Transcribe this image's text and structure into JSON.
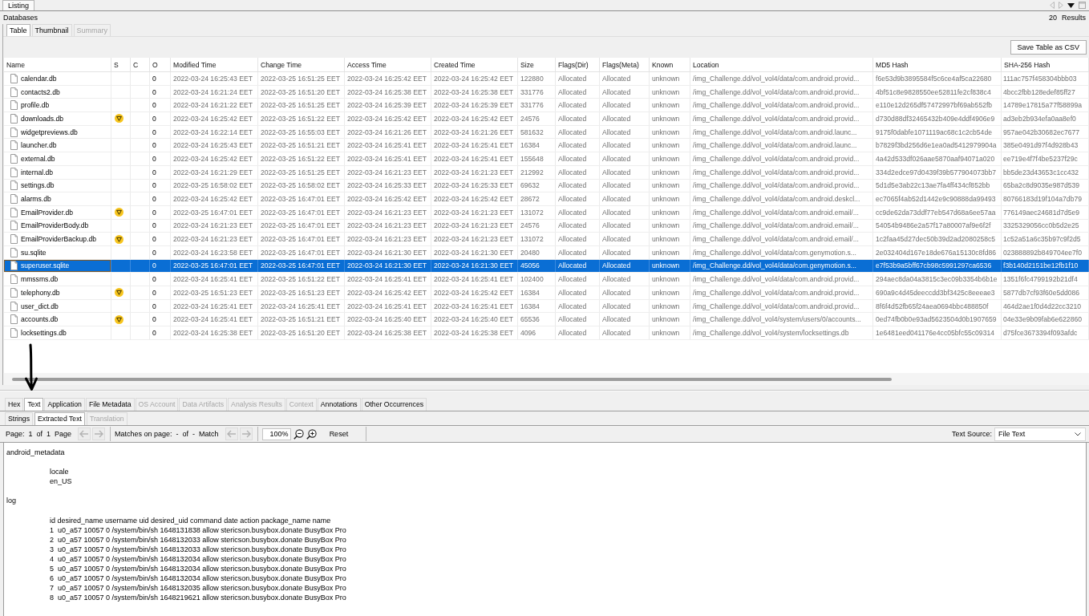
{
  "view_tabs": [
    {
      "label": "Listing",
      "selected": true
    }
  ],
  "breadcrumb": "Databases",
  "results": {
    "count": "20",
    "label": "Results"
  },
  "listing_tabs": [
    {
      "label": "Table",
      "selected": true,
      "disabled": false
    },
    {
      "label": "Thumbnail",
      "selected": false,
      "disabled": false
    },
    {
      "label": "Summary",
      "selected": false,
      "disabled": true
    }
  ],
  "save_button": "Save Table as CSV",
  "table": {
    "columns": [
      "Name",
      "S",
      "C",
      "O",
      "Modified Time",
      "Change Time",
      "Access Time",
      "Created Time",
      "Size",
      "Flags(Dir)",
      "Flags(Meta)",
      "Known",
      "Location",
      "MD5 Hash",
      "SHA-256 Hash"
    ],
    "rows": [
      {
        "name": "calendar.db",
        "score_marked": false,
        "o": "0",
        "modified": "2022-03-24 16:25:43 EET",
        "changed": "2022-03-25 16:51:25 EET",
        "accessed": "2022-03-24 16:25:42 EET",
        "created": "2022-03-24 16:25:42 EET",
        "size": "122880",
        "flags_dir": "Allocated",
        "flags_meta": "Allocated",
        "known": "unknown",
        "location": "/img_Challenge.dd/vol_vol4/data/com.android.provid...",
        "md5": "f6e53d9b3895584f5c6ce4af5ca22680",
        "sha256": "111ac757f458304bbb03",
        "selected": false
      },
      {
        "name": "contacts2.db",
        "score_marked": false,
        "o": "0",
        "modified": "2022-03-24 16:21:24 EET",
        "changed": "2022-03-25 16:51:20 EET",
        "accessed": "2022-03-24 16:25:38 EET",
        "created": "2022-03-24 16:25:38 EET",
        "size": "331776",
        "flags_dir": "Allocated",
        "flags_meta": "Allocated",
        "known": "unknown",
        "location": "/img_Challenge.dd/vol_vol4/data/com.android.provid...",
        "md5": "4bf51c8e9828550ee52811fe2cf838c4",
        "sha256": "4bcc2fbb128edef85ff27",
        "selected": false
      },
      {
        "name": "profile.db",
        "score_marked": false,
        "o": "0",
        "modified": "2022-03-24 16:21:22 EET",
        "changed": "2022-03-25 16:51:25 EET",
        "accessed": "2022-03-24 16:25:39 EET",
        "created": "2022-03-24 16:25:39 EET",
        "size": "331776",
        "flags_dir": "Allocated",
        "flags_meta": "Allocated",
        "known": "unknown",
        "location": "/img_Challenge.dd/vol_vol4/data/com.android.provid...",
        "md5": "e110e12d265df57472997bf69ab552fb",
        "sha256": "14789e17815a77f58899a",
        "selected": false
      },
      {
        "name": "downloads.db",
        "score_marked": true,
        "o": "0",
        "modified": "2022-03-24 16:25:42 EET",
        "changed": "2022-03-25 16:51:22 EET",
        "accessed": "2022-03-24 16:25:42 EET",
        "created": "2022-03-24 16:25:42 EET",
        "size": "24576",
        "flags_dir": "Allocated",
        "flags_meta": "Allocated",
        "known": "unknown",
        "location": "/img_Challenge.dd/vol_vol4/data/com.android.provid...",
        "md5": "d730d88df32465432b409e4ddf4906e9",
        "sha256": "ad3eb2b934efa0aa8ef0",
        "selected": false
      },
      {
        "name": "widgetpreviews.db",
        "score_marked": false,
        "o": "0",
        "modified": "2022-03-24 16:22:14 EET",
        "changed": "2022-03-25 16:55:03 EET",
        "accessed": "2022-03-24 16:21:26 EET",
        "created": "2022-03-24 16:21:26 EET",
        "size": "581632",
        "flags_dir": "Allocated",
        "flags_meta": "Allocated",
        "known": "unknown",
        "location": "/img_Challenge.dd/vol_vol4/data/com.android.launc...",
        "md5": "9175f0dabfe1071119ac68c1c2cb54de",
        "sha256": "957ae042b30682ec7677",
        "selected": false
      },
      {
        "name": "launcher.db",
        "score_marked": false,
        "o": "0",
        "modified": "2022-03-24 16:25:43 EET",
        "changed": "2022-03-25 16:51:21 EET",
        "accessed": "2022-03-24 16:25:41 EET",
        "created": "2022-03-24 16:25:41 EET",
        "size": "16384",
        "flags_dir": "Allocated",
        "flags_meta": "Allocated",
        "known": "unknown",
        "location": "/img_Challenge.dd/vol_vol4/data/com.android.launc...",
        "md5": "b7829f3bd256d6e1ea0ad5412979904a",
        "sha256": "385e0491d97f4d928b43",
        "selected": false
      },
      {
        "name": "external.db",
        "score_marked": false,
        "o": "0",
        "modified": "2022-03-24 16:25:42 EET",
        "changed": "2022-03-25 16:51:22 EET",
        "accessed": "2022-03-24 16:25:41 EET",
        "created": "2022-03-24 16:25:41 EET",
        "size": "155648",
        "flags_dir": "Allocated",
        "flags_meta": "Allocated",
        "known": "unknown",
        "location": "/img_Challenge.dd/vol_vol4/data/com.android.provid...",
        "md5": "4a42d533df026aae5870aaf94071a020",
        "sha256": "ee719e4f7f4be5237f29c",
        "selected": false
      },
      {
        "name": "internal.db",
        "score_marked": false,
        "o": "0",
        "modified": "2022-03-24 16:21:29 EET",
        "changed": "2022-03-25 16:51:25 EET",
        "accessed": "2022-03-24 16:21:23 EET",
        "created": "2022-03-24 16:21:23 EET",
        "size": "212992",
        "flags_dir": "Allocated",
        "flags_meta": "Allocated",
        "known": "unknown",
        "location": "/img_Challenge.dd/vol_vol4/data/com.android.provid...",
        "md5": "334d2edce97d0439f39b577904073bb7",
        "sha256": "bb5de23d43653c1cc432",
        "selected": false
      },
      {
        "name": "settings.db",
        "score_marked": false,
        "o": "0",
        "modified": "2022-03-25 16:58:02 EET",
        "changed": "2022-03-25 16:58:02 EET",
        "accessed": "2022-03-24 16:25:33 EET",
        "created": "2022-03-24 16:25:33 EET",
        "size": "69632",
        "flags_dir": "Allocated",
        "flags_meta": "Allocated",
        "known": "unknown",
        "location": "/img_Challenge.dd/vol_vol4/data/com.android.provid...",
        "md5": "5d1d5e3ab22c13ae7fa4ff434cf852bb",
        "sha256": "65ba2c8d9035e987d539",
        "selected": false
      },
      {
        "name": "alarms.db",
        "score_marked": false,
        "o": "0",
        "modified": "2022-03-24 16:25:42 EET",
        "changed": "2022-03-25 16:47:01 EET",
        "accessed": "2022-03-24 16:25:42 EET",
        "created": "2022-03-24 16:25:42 EET",
        "size": "28672",
        "flags_dir": "Allocated",
        "flags_meta": "Allocated",
        "known": "unknown",
        "location": "/img_Challenge.dd/vol_vol4/data/com.android.deskcl...",
        "md5": "ec7065f4ab52d1442e9c90888da99493",
        "sha256": "80766183d19f104a7db79",
        "selected": false
      },
      {
        "name": "EmailProvider.db",
        "score_marked": true,
        "o": "0",
        "modified": "2022-03-25 16:47:01 EET",
        "changed": "2022-03-25 16:47:01 EET",
        "accessed": "2022-03-24 16:21:23 EET",
        "created": "2022-03-24 16:21:23 EET",
        "size": "131072",
        "flags_dir": "Allocated",
        "flags_meta": "Allocated",
        "known": "unknown",
        "location": "/img_Challenge.dd/vol_vol4/data/com.android.email/...",
        "md5": "cc9de62da73ddf77eb547d68a6ee57aa",
        "sha256": "776149aec24681d7d5e9",
        "selected": false
      },
      {
        "name": "EmailProviderBody.db",
        "score_marked": false,
        "o": "0",
        "modified": "2022-03-24 16:21:23 EET",
        "changed": "2022-03-25 16:47:01 EET",
        "accessed": "2022-03-24 16:21:23 EET",
        "created": "2022-03-24 16:21:23 EET",
        "size": "24576",
        "flags_dir": "Allocated",
        "flags_meta": "Allocated",
        "known": "unknown",
        "location": "/img_Challenge.dd/vol_vol4/data/com.android.email/...",
        "md5": "54054b9486e2a57f17a80007af9e6f2f",
        "sha256": "3325329056cc0b5d2e25",
        "selected": false
      },
      {
        "name": "EmailProviderBackup.db",
        "score_marked": true,
        "o": "0",
        "modified": "2022-03-24 16:21:23 EET",
        "changed": "2022-03-25 16:47:01 EET",
        "accessed": "2022-03-24 16:21:23 EET",
        "created": "2022-03-24 16:21:23 EET",
        "size": "131072",
        "flags_dir": "Allocated",
        "flags_meta": "Allocated",
        "known": "unknown",
        "location": "/img_Challenge.dd/vol_vol4/data/com.android.email/...",
        "md5": "1c2faa45d27dec50b39d2ad2080258c5",
        "sha256": "1c52a51a6c35b97c9f2d5",
        "selected": false
      },
      {
        "name": "su.sqlite",
        "score_marked": false,
        "o": "0",
        "modified": "2022-03-24 16:23:58 EET",
        "changed": "2022-03-25 16:47:01 EET",
        "accessed": "2022-03-24 16:21:30 EET",
        "created": "2022-03-24 16:21:30 EET",
        "size": "20480",
        "flags_dir": "Allocated",
        "flags_meta": "Allocated",
        "known": "unknown",
        "location": "/img_Challenge.dd/vol_vol4/data/com.genymotion.s...",
        "md5": "2e032404d167e18de676a15130c8fd86",
        "sha256": "023888892b849704ee7f0",
        "selected": false
      },
      {
        "name": "superuser.sqlite",
        "score_marked": false,
        "o": "0",
        "modified": "2022-03-25 16:47:01 EET",
        "changed": "2022-03-25 16:47:01 EET",
        "accessed": "2022-03-24 16:21:30 EET",
        "created": "2022-03-24 16:21:30 EET",
        "size": "45056",
        "flags_dir": "Allocated",
        "flags_meta": "Allocated",
        "known": "unknown",
        "location": "/img_Challenge.dd/vol_vol4/data/com.genymotion.s...",
        "md5": "e7f53b9a5bff67cb98c5991297ca6536",
        "sha256": "f3b140d2151be12fb1f10",
        "selected": true
      },
      {
        "name": "mmssms.db",
        "score_marked": false,
        "o": "0",
        "modified": "2022-03-24 16:25:41 EET",
        "changed": "2022-03-25 16:51:22 EET",
        "accessed": "2022-03-24 16:25:41 EET",
        "created": "2022-03-24 16:25:41 EET",
        "size": "102400",
        "flags_dir": "Allocated",
        "flags_meta": "Allocated",
        "known": "unknown",
        "location": "/img_Challenge.dd/vol_vol4/data/com.android.provid...",
        "md5": "294aec8da04a3815c3ec09b3354b6b1e",
        "sha256": "1351f6fc4799192b21df4",
        "selected": false
      },
      {
        "name": "telephony.db",
        "score_marked": true,
        "o": "0",
        "modified": "2022-03-25 16:51:23 EET",
        "changed": "2022-03-25 16:51:23 EET",
        "accessed": "2022-03-24 16:25:42 EET",
        "created": "2022-03-24 16:25:42 EET",
        "size": "16384",
        "flags_dir": "Allocated",
        "flags_meta": "Allocated",
        "known": "unknown",
        "location": "/img_Challenge.dd/vol_vol4/data/com.android.provid...",
        "md5": "690a9c4d45deeccdd3bf3425c8eeeae3",
        "sha256": "5877db7cf93f60e5dd086",
        "selected": false
      },
      {
        "name": "user_dict.db",
        "score_marked": false,
        "o": "0",
        "modified": "2022-03-24 16:25:41 EET",
        "changed": "2022-03-24 16:25:41 EET",
        "accessed": "2022-03-24 16:25:41 EET",
        "created": "2022-03-24 16:25:41 EET",
        "size": "16384",
        "flags_dir": "Allocated",
        "flags_meta": "Allocated",
        "known": "unknown",
        "location": "/img_Challenge.dd/vol_vol4/data/com.android.provid...",
        "md5": "8f6f4d52fb65f24aea0694bbc488850f",
        "sha256": "464d2ae1f0d4d22cc3210",
        "selected": false
      },
      {
        "name": "accounts.db",
        "score_marked": true,
        "o": "0",
        "modified": "2022-03-24 16:25:41 EET",
        "changed": "2022-03-25 16:51:21 EET",
        "accessed": "2022-03-24 16:25:40 EET",
        "created": "2022-03-24 16:25:40 EET",
        "size": "65536",
        "flags_dir": "Allocated",
        "flags_meta": "Allocated",
        "known": "unknown",
        "location": "/img_Challenge.dd/vol_vol4/system/users/0/accounts...",
        "md5": "0ed74fb0b0e93ad5623504d0b1907659",
        "sha256": "04e33e9b09fab6e622860",
        "selected": false
      },
      {
        "name": "locksettings.db",
        "score_marked": false,
        "o": "0",
        "modified": "2022-03-24 16:25:38 EET",
        "changed": "2022-03-25 16:51:20 EET",
        "accessed": "2022-03-24 16:25:38 EET",
        "created": "2022-03-24 16:25:38 EET",
        "size": "4096",
        "flags_dir": "Allocated",
        "flags_meta": "Allocated",
        "known": "unknown",
        "location": "/img_Challenge.dd/vol_vol4/system/locksettings.db",
        "md5": "1e6481eed041176e4cc05bfc55c09314",
        "sha256": "d75fce3673394f093afdc",
        "selected": false
      }
    ]
  },
  "content_tabs": [
    {
      "label": "Hex",
      "selected": false,
      "disabled": false
    },
    {
      "label": "Text",
      "selected": true,
      "disabled": false
    },
    {
      "label": "Application",
      "selected": false,
      "disabled": false
    },
    {
      "label": "File Metadata",
      "selected": false,
      "disabled": false
    },
    {
      "label": "OS Account",
      "selected": false,
      "disabled": true
    },
    {
      "label": "Data Artifacts",
      "selected": false,
      "disabled": true
    },
    {
      "label": "Analysis Results",
      "selected": false,
      "disabled": true
    },
    {
      "label": "Context",
      "selected": false,
      "disabled": true
    },
    {
      "label": "Annotations",
      "selected": false,
      "disabled": false
    },
    {
      "label": "Other Occurrences",
      "selected": false,
      "disabled": false
    }
  ],
  "text_tabs": [
    {
      "label": "Strings",
      "selected": false,
      "disabled": false
    },
    {
      "label": "Extracted Text",
      "selected": true,
      "disabled": false
    },
    {
      "label": "Translation",
      "selected": false,
      "disabled": true
    }
  ],
  "viewer_toolbar": {
    "page_info": "Page:  1  of  1  Page",
    "page_nav": [
      {
        "kind": "prev",
        "disabled": true
      },
      {
        "kind": "next",
        "disabled": true
      }
    ],
    "match_info": "Matches on page:  -  of  -  Match",
    "match_nav": [
      {
        "kind": "prev",
        "disabled": true
      },
      {
        "kind": "next",
        "disabled": true
      }
    ],
    "zoom": "100%",
    "reset": "Reset",
    "text_source_label": "Text Source:",
    "text_source": "File Text"
  },
  "extracted_text": {
    "sections": [
      {
        "title": "android_metadata",
        "lines": [
          "locale",
          "en_US"
        ]
      },
      {
        "title": "log",
        "lines": [
          "id desired_name username uid desired_uid command date action package_name name",
          "1  u0_a57 10057 0 /system/bin/sh 1648131838 allow stericson.busybox.donate BusyBox Pro",
          "2  u0_a57 10057 0 /system/bin/sh 1648132033 allow stericson.busybox.donate BusyBox Pro",
          "3  u0_a57 10057 0 /system/bin/sh 1648132033 allow stericson.busybox.donate BusyBox Pro",
          "4  u0_a57 10057 0 /system/bin/sh 1648132034 allow stericson.busybox.donate BusyBox Pro",
          "5  u0_a57 10057 0 /system/bin/sh 1648132034 allow stericson.busybox.donate BusyBox Pro",
          "6  u0_a57 10057 0 /system/bin/sh 1648132034 allow stericson.busybox.donate BusyBox Pro",
          "7  u0_a57 10057 0 /system/bin/sh 1648132035 allow stericson.busybox.donate BusyBox Pro",
          "8  u0_a57 10057 0 /system/bin/sh 1648219621 allow stericson.busybox.donate BusyBox Pro"
        ]
      }
    ]
  }
}
